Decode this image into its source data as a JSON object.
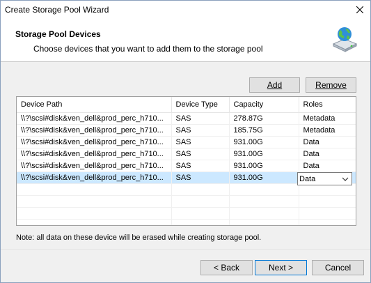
{
  "window": {
    "title": "Create Storage Pool Wizard"
  },
  "header": {
    "title": "Storage Pool Devices",
    "subtitle": "Choose devices that you want to add them to the storage pool"
  },
  "toolbar": {
    "add_label": "Add",
    "remove_label": "Remove"
  },
  "table": {
    "columns": [
      "Device Path",
      "Device Type",
      "Capacity",
      "Roles"
    ],
    "rows": [
      {
        "path": "\\\\?\\scsi#disk&ven_dell&prod_perc_h710...",
        "type": "SAS",
        "capacity": "278.87G",
        "role": "Metadata"
      },
      {
        "path": "\\\\?\\scsi#disk&ven_dell&prod_perc_h710...",
        "type": "SAS",
        "capacity": "185.75G",
        "role": "Metadata"
      },
      {
        "path": "\\\\?\\scsi#disk&ven_dell&prod_perc_h710...",
        "type": "SAS",
        "capacity": "931.00G",
        "role": "Data"
      },
      {
        "path": "\\\\?\\scsi#disk&ven_dell&prod_perc_h710...",
        "type": "SAS",
        "capacity": "931.00G",
        "role": "Data"
      },
      {
        "path": "\\\\?\\scsi#disk&ven_dell&prod_perc_h710...",
        "type": "SAS",
        "capacity": "931.00G",
        "role": "Data"
      },
      {
        "path": "\\\\?\\scsi#disk&ven_dell&prod_perc_h710...",
        "type": "SAS",
        "capacity": "931.00G",
        "role": "Data"
      }
    ],
    "selected_row": 5,
    "selected_role_value": "Data"
  },
  "note": "Note: all data on these device will be erased while creating storage pool.",
  "footer": {
    "back_label": "< Back",
    "next_label": "Next >",
    "cancel_label": "Cancel"
  },
  "colors": {
    "selection": "#cce8ff",
    "default_button_border": "#0078d7"
  }
}
